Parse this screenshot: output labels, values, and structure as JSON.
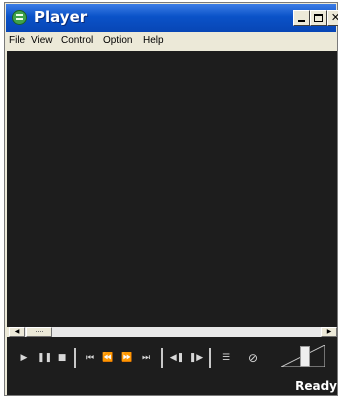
{
  "window": {
    "title": "Player"
  },
  "titlebar_buttons": {
    "minimize": "minimize-icon",
    "maximize": "maximize-icon",
    "close": "✕"
  },
  "menu": [
    "File",
    "View",
    "Control",
    "Option",
    "Help"
  ],
  "controls": {
    "play": "▶",
    "pause": "❚❚",
    "stop": "■",
    "prev": "⏮",
    "rewind": "⏪",
    "forward": "⏩",
    "next": "⏭",
    "step_back": "◀❚",
    "step_forward": "❚▶",
    "playlist": "☰",
    "mute": "⊘"
  },
  "volume": {
    "level": 0.55
  },
  "status": {
    "text": "Ready"
  },
  "colors": {
    "titlebar": "#0a52c8",
    "video_bg": "#1d1d1d",
    "window_bg": "#ece9d8"
  }
}
